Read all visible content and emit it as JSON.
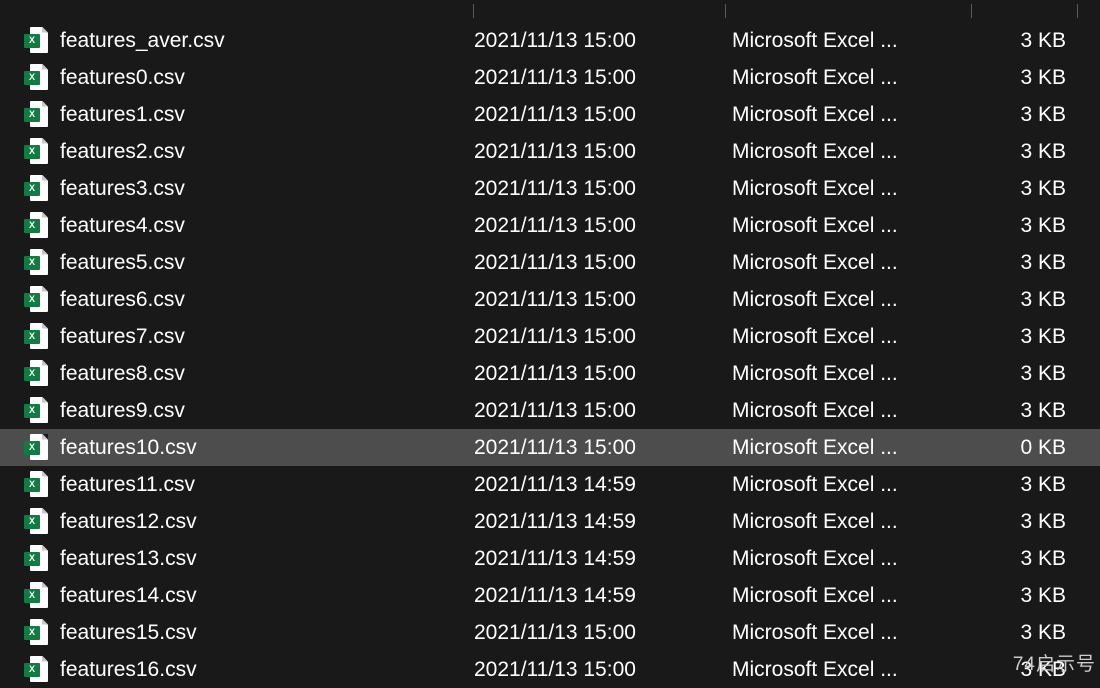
{
  "watermark": "74启示号",
  "files": [
    {
      "name": "features_aver.csv",
      "date": "2021/11/13 15:00",
      "type": "Microsoft Excel ...",
      "size": "3 KB",
      "selected": false
    },
    {
      "name": "features0.csv",
      "date": "2021/11/13 15:00",
      "type": "Microsoft Excel ...",
      "size": "3 KB",
      "selected": false
    },
    {
      "name": "features1.csv",
      "date": "2021/11/13 15:00",
      "type": "Microsoft Excel ...",
      "size": "3 KB",
      "selected": false
    },
    {
      "name": "features2.csv",
      "date": "2021/11/13 15:00",
      "type": "Microsoft Excel ...",
      "size": "3 KB",
      "selected": false
    },
    {
      "name": "features3.csv",
      "date": "2021/11/13 15:00",
      "type": "Microsoft Excel ...",
      "size": "3 KB",
      "selected": false
    },
    {
      "name": "features4.csv",
      "date": "2021/11/13 15:00",
      "type": "Microsoft Excel ...",
      "size": "3 KB",
      "selected": false
    },
    {
      "name": "features5.csv",
      "date": "2021/11/13 15:00",
      "type": "Microsoft Excel ...",
      "size": "3 KB",
      "selected": false
    },
    {
      "name": "features6.csv",
      "date": "2021/11/13 15:00",
      "type": "Microsoft Excel ...",
      "size": "3 KB",
      "selected": false
    },
    {
      "name": "features7.csv",
      "date": "2021/11/13 15:00",
      "type": "Microsoft Excel ...",
      "size": "3 KB",
      "selected": false
    },
    {
      "name": "features8.csv",
      "date": "2021/11/13 15:00",
      "type": "Microsoft Excel ...",
      "size": "3 KB",
      "selected": false
    },
    {
      "name": "features9.csv",
      "date": "2021/11/13 15:00",
      "type": "Microsoft Excel ...",
      "size": "3 KB",
      "selected": false
    },
    {
      "name": "features10.csv",
      "date": "2021/11/13 15:00",
      "type": "Microsoft Excel ...",
      "size": "0 KB",
      "selected": true
    },
    {
      "name": "features11.csv",
      "date": "2021/11/13 14:59",
      "type": "Microsoft Excel ...",
      "size": "3 KB",
      "selected": false
    },
    {
      "name": "features12.csv",
      "date": "2021/11/13 14:59",
      "type": "Microsoft Excel ...",
      "size": "3 KB",
      "selected": false
    },
    {
      "name": "features13.csv",
      "date": "2021/11/13 14:59",
      "type": "Microsoft Excel ...",
      "size": "3 KB",
      "selected": false
    },
    {
      "name": "features14.csv",
      "date": "2021/11/13 14:59",
      "type": "Microsoft Excel ...",
      "size": "3 KB",
      "selected": false
    },
    {
      "name": "features15.csv",
      "date": "2021/11/13 15:00",
      "type": "Microsoft Excel ...",
      "size": "3 KB",
      "selected": false
    },
    {
      "name": "features16.csv",
      "date": "2021/11/13 15:00",
      "type": "Microsoft Excel ...",
      "size": "3 KB",
      "selected": false
    }
  ]
}
